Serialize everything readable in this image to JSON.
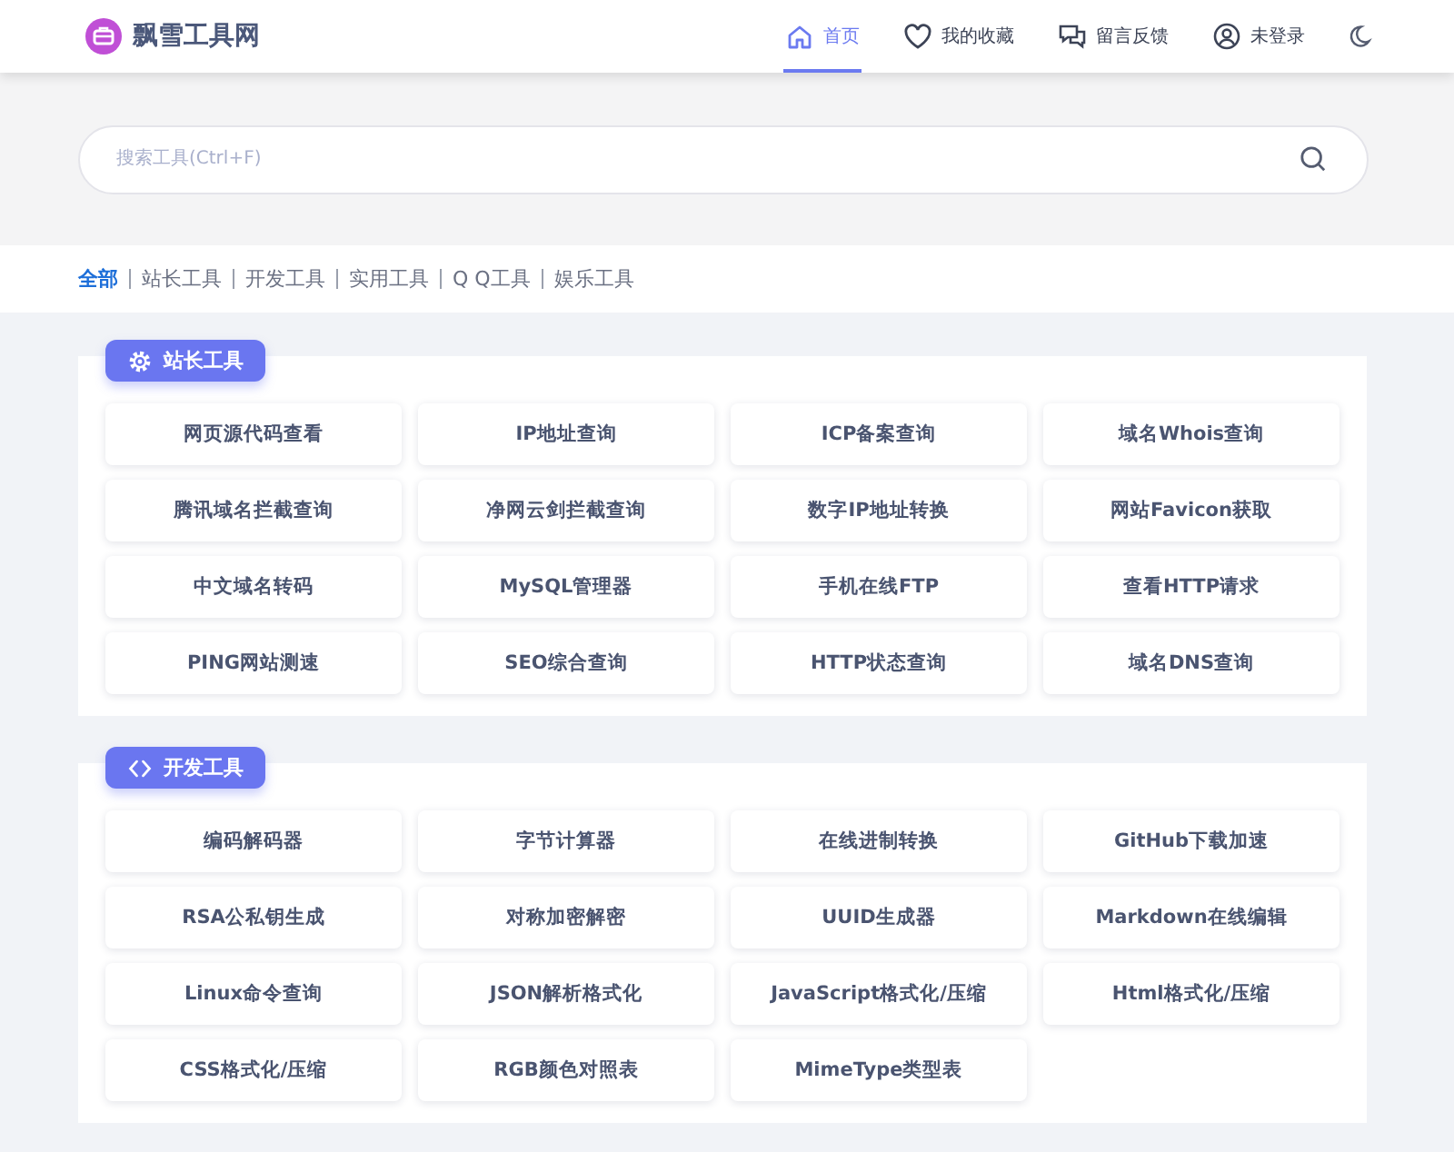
{
  "header": {
    "site_title": "飘雪工具网",
    "nav": [
      {
        "label": "首页",
        "kind": "home",
        "selected": true
      },
      {
        "label": "我的收藏",
        "kind": "heart",
        "selected": false
      },
      {
        "label": "留言反馈",
        "kind": "chat",
        "selected": false
      },
      {
        "label": "未登录",
        "kind": "user",
        "selected": false
      }
    ]
  },
  "search": {
    "placeholder": "搜索工具(Ctrl+F)"
  },
  "categories": [
    {
      "label": "全部",
      "selected": true
    },
    {
      "label": "站长工具",
      "selected": false
    },
    {
      "label": "开发工具",
      "selected": false
    },
    {
      "label": "实用工具",
      "selected": false
    },
    {
      "label": "Q Q工具",
      "selected": false
    },
    {
      "label": "娱乐工具",
      "selected": false
    }
  ],
  "sections": [
    {
      "title": "站长工具",
      "kind": "gear",
      "tools": [
        "网页源代码查看",
        "IP地址查询",
        "ICP备案查询",
        "域名Whois查询",
        "腾讯域名拦截查询",
        "净网云剑拦截查询",
        "数字IP地址转换",
        "网站Favicon获取",
        "中文域名转码",
        "MySQL管理器",
        "手机在线FTP",
        "查看HTTP请求",
        "PING网站测速",
        "SEO综合查询",
        "HTTP状态查询",
        "域名DNS查询"
      ]
    },
    {
      "title": "开发工具",
      "kind": "code",
      "tools": [
        "编码解码器",
        "字节计算器",
        "在线进制转换",
        "GitHub下载加速",
        "RSA公私钥生成",
        "对称加密解密",
        "UUID生成器",
        "Markdown在线编辑",
        "Linux命令查询",
        "JSON解析格式化",
        "JavaScript格式化/压缩",
        "Html格式化/压缩",
        "CSS格式化/压缩",
        "RGB颜色对照表",
        "MimeType类型表"
      ]
    }
  ]
}
